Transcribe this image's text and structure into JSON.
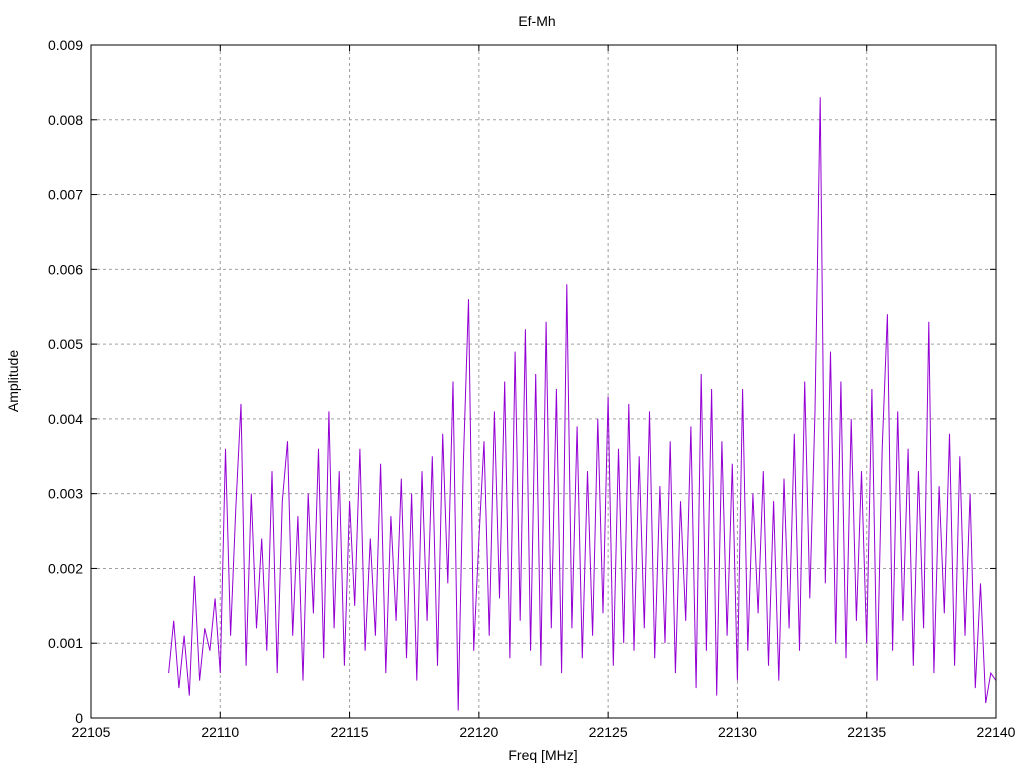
{
  "chart_data": {
    "type": "line",
    "title": "Ef-Mh",
    "xlabel": "Freq [MHz]",
    "ylabel": "Amplitude",
    "xlim": [
      22105,
      22140
    ],
    "ylim": [
      0,
      0.009
    ],
    "grid": true,
    "x_ticks": [
      "22105",
      "22110",
      "22115",
      "22120",
      "22125",
      "22130",
      "22135",
      "22140"
    ],
    "y_ticks": [
      "0",
      "0.001",
      "0.002",
      "0.003",
      "0.004",
      "0.005",
      "0.006",
      "0.007",
      "0.008",
      "0.009"
    ],
    "series": [
      {
        "name": "Ef-Mh",
        "color": "#9400d3",
        "x_start": 22108.0,
        "x_step": 0.2,
        "values": [
          0.0006,
          0.0013,
          0.0004,
          0.0011,
          0.0003,
          0.0019,
          0.0005,
          0.0012,
          0.0009,
          0.0016,
          0.0006,
          0.0036,
          0.0011,
          0.0028,
          0.0042,
          0.0007,
          0.003,
          0.0012,
          0.0024,
          0.0009,
          0.0033,
          0.0006,
          0.0029,
          0.0037,
          0.0011,
          0.0027,
          0.0005,
          0.003,
          0.0014,
          0.0036,
          0.0008,
          0.0041,
          0.0012,
          0.0033,
          0.0007,
          0.0029,
          0.0015,
          0.0036,
          0.0009,
          0.0024,
          0.0011,
          0.0034,
          0.0006,
          0.0027,
          0.0013,
          0.0032,
          0.0008,
          0.003,
          0.0005,
          0.0033,
          0.0013,
          0.0035,
          0.0007,
          0.0038,
          0.0018,
          0.0045,
          0.0001,
          0.0034,
          0.0056,
          0.0009,
          0.0024,
          0.0037,
          0.0011,
          0.0041,
          0.0016,
          0.0045,
          0.0008,
          0.0049,
          0.0013,
          0.0052,
          0.0009,
          0.0046,
          0.0007,
          0.0053,
          0.0012,
          0.0044,
          0.0006,
          0.0058,
          0.0012,
          0.0039,
          0.0008,
          0.0033,
          0.0011,
          0.004,
          0.0014,
          0.0043,
          0.0007,
          0.0036,
          0.001,
          0.0042,
          0.0009,
          0.0035,
          0.0012,
          0.0041,
          0.0008,
          0.0031,
          0.001,
          0.0037,
          0.0006,
          0.0029,
          0.0013,
          0.0039,
          0.0004,
          0.0046,
          0.0009,
          0.0044,
          0.0003,
          0.0037,
          0.0011,
          0.0034,
          0.0005,
          0.0044,
          0.0009,
          0.003,
          0.0014,
          0.0033,
          0.0007,
          0.0029,
          0.0005,
          0.0032,
          0.0012,
          0.0038,
          0.0009,
          0.0045,
          0.0016,
          0.0041,
          0.0083,
          0.0018,
          0.0049,
          0.001,
          0.0045,
          0.0008,
          0.004,
          0.0013,
          0.0033,
          0.001,
          0.0044,
          0.0005,
          0.0036,
          0.0054,
          0.0009,
          0.0041,
          0.0013,
          0.0036,
          0.0007,
          0.0033,
          0.0012,
          0.0053,
          0.0006,
          0.0031,
          0.0014,
          0.0038,
          0.0007,
          0.0035,
          0.0011,
          0.003,
          0.0004,
          0.0018,
          0.0002,
          0.0006,
          0.0005
        ]
      }
    ]
  }
}
